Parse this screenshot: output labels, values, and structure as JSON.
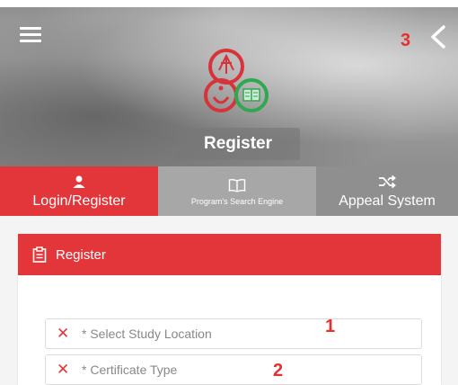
{
  "header": {
    "title": "Register",
    "menu_icon": "hamburger-menu-icon",
    "back_icon": "chevron-left-icon",
    "logo_icon": "ministry-logo-icon"
  },
  "annotations": {
    "marker_1": "1",
    "marker_2": "2",
    "marker_3": "3"
  },
  "tabs": [
    {
      "label": "Login/Register",
      "icon": "user-icon",
      "active": true
    },
    {
      "label": "Program's Search Engine",
      "icon": "book-icon",
      "active": false
    },
    {
      "label": "Appeal System",
      "icon": "shuffle-icon",
      "active": false
    }
  ],
  "panel": {
    "title": "Register",
    "icon": "clipboard-icon"
  },
  "form": {
    "study_location": {
      "placeholder": "* Select Study Location",
      "status_icon": "x-icon",
      "status_glyph": "✕"
    },
    "certificate_type": {
      "placeholder": "* Certificate Type",
      "status_icon": "x-icon",
      "status_glyph": "✕"
    }
  },
  "colors": {
    "accent": "#e2363a",
    "tab_inactive_1": "#a7a7a7",
    "tab_inactive_2": "#8f8f8f",
    "marker": "#e63030"
  }
}
